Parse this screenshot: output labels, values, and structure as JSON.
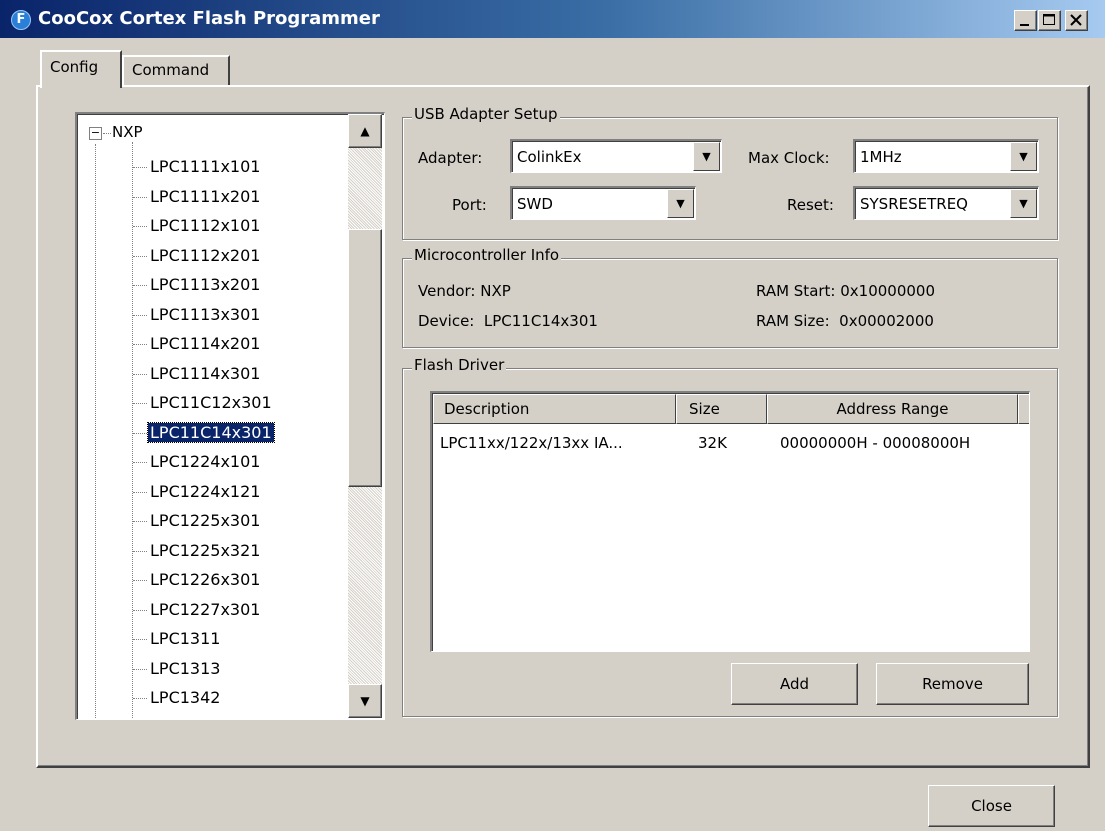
{
  "window": {
    "title": "CooCox Cortex Flash Programmer",
    "icon_letter": "F",
    "minimize_icon": "minimize-icon",
    "maximize_icon": "maximize-icon",
    "close_icon": "close-icon"
  },
  "tabs": [
    {
      "label": "Config",
      "selected": true
    },
    {
      "label": "Command",
      "selected": false
    }
  ],
  "tree": {
    "root": {
      "label": "NXP",
      "expander": "−"
    },
    "items": [
      "LPC1111x101",
      "LPC1111x201",
      "LPC1112x101",
      "LPC1112x201",
      "LPC1113x201",
      "LPC1113x301",
      "LPC1114x201",
      "LPC1114x301",
      "LPC11C12x301",
      "LPC11C14x301",
      "LPC1224x101",
      "LPC1224x121",
      "LPC1225x301",
      "LPC1225x321",
      "LPC1226x301",
      "LPC1227x301",
      "LPC1311",
      "LPC1313",
      "LPC1342"
    ],
    "selected_index": 9,
    "scroll_up_icon": "▲",
    "scroll_down_icon": "▼"
  },
  "usb_adapter": {
    "title": "USB Adapter Setup",
    "adapter_label": "Adapter:",
    "adapter_value": "ColinkEx",
    "port_label": "Port:",
    "port_value": "SWD",
    "max_clock_label": "Max Clock:",
    "max_clock_value": "1MHz",
    "reset_label": "Reset:",
    "reset_value": "SYSRESETREQ",
    "dropdown_arrow": "▼"
  },
  "mcu_info": {
    "title": "Microcontroller Info",
    "vendor": "Vendor: NXP",
    "device": "Device:  LPC11C14x301",
    "ram_start": "RAM Start: 0x10000000",
    "ram_size": "RAM Size:  0x00002000"
  },
  "flash_driver": {
    "title": "Flash Driver",
    "columns": [
      "Description",
      "Size",
      "Address Range"
    ],
    "rows": [
      {
        "description": "LPC11xx/122x/13xx IA...",
        "size": "32K",
        "address_range": "00000000H - 00008000H"
      }
    ],
    "add_label": "Add",
    "remove_label": "Remove"
  },
  "footer": {
    "close_label": "Close"
  }
}
